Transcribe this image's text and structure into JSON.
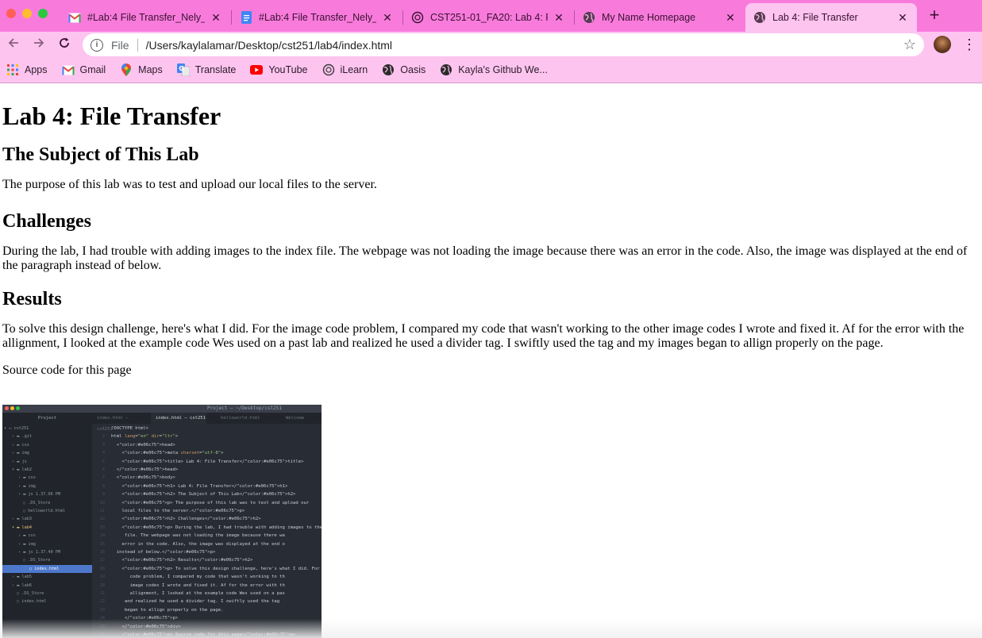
{
  "window": {
    "traffic_lights": {
      "close_color": "#fe5f57",
      "minimize_color": "#febc2e",
      "zoom_color": "#28c840"
    }
  },
  "tabs": [
    {
      "title": "#Lab:4 File Transfer_Nely_",
      "icon": "gmail-icon",
      "active": false
    },
    {
      "title": "#Lab:4 File Transfer_Nely_",
      "icon": "google-docs-icon",
      "active": false
    },
    {
      "title": "CST251-01_FA20: Lab 4: F",
      "icon": "ilearn-icon",
      "active": false
    },
    {
      "title": "My Name Homepage",
      "icon": "globe-icon",
      "active": false
    },
    {
      "title": "Lab 4: File Transfer",
      "icon": "globe-icon",
      "active": true
    }
  ],
  "toolbar": {
    "scheme_label": "File",
    "url": "/Users/kaylalamar/Desktop/cst251/lab4/index.html"
  },
  "bookmarks": [
    {
      "label": "Apps",
      "icon": "apps-grid-icon"
    },
    {
      "label": "Gmail",
      "icon": "gmail-icon"
    },
    {
      "label": "Maps",
      "icon": "maps-pin-icon"
    },
    {
      "label": "Translate",
      "icon": "translate-icon"
    },
    {
      "label": "YouTube",
      "icon": "youtube-icon"
    },
    {
      "label": "iLearn",
      "icon": "ilearn-icon"
    },
    {
      "label": "Oasis",
      "icon": "globe-icon"
    },
    {
      "label": "Kayla's Github We...",
      "icon": "globe-icon"
    }
  ],
  "theme": {
    "tabstrip_bg": "#f87bdc",
    "toolbar_bg": "#fdc4f0"
  },
  "page": {
    "title": "Lab 4: File Transfer",
    "subject_heading": "The Subject of This Lab",
    "subject_text": "The purpose of this lab was to test and upload our local files to the server.",
    "challenges_heading": "Challenges",
    "challenges_text": "During the lab, I had trouble with adding images to the index file. The webpage was not loading the image because there was an error in the code. Also, the image was displayed at the end of the paragraph instead of below.",
    "results_heading": "Results",
    "results_text": "To solve this design challenge, here's what I did. For the image code problem, I compared my code that wasn't working to the other image codes I wrote and fixed it. Af for the error with the allignment, I looked at the example code Wes used on a past lab and realized he used a divider tag. I swiftly used the tag and my images began to allign properly on the page.",
    "source_label": "Source code for this page"
  },
  "editor_screenshot": {
    "window_title": "Project — ~/Desktop/cst251",
    "project_header": "Project",
    "tabs": [
      "index.html — cst251",
      "index.html — cst251",
      "helloworld.html",
      "Welcome"
    ],
    "active_tab_index": 1,
    "tree": [
      {
        "label": "cst251",
        "kind": "root"
      },
      {
        "label": ".git",
        "kind": "folder"
      },
      {
        "label": "css",
        "kind": "folder"
      },
      {
        "label": "img",
        "kind": "folder"
      },
      {
        "label": "js",
        "kind": "folder"
      },
      {
        "label": "lab2",
        "kind": "folder-open"
      },
      {
        "label": "css",
        "kind": "folder"
      },
      {
        "label": "img",
        "kind": "folder"
      },
      {
        "label": "js 1.37.06 PM",
        "kind": "folder"
      },
      {
        "label": ".DS_Store",
        "kind": "file"
      },
      {
        "label": "helloworld.html",
        "kind": "file"
      },
      {
        "label": "lab3",
        "kind": "folder"
      },
      {
        "label": "lab4",
        "kind": "folder-open"
      },
      {
        "label": "css",
        "kind": "folder"
      },
      {
        "label": "img",
        "kind": "folder"
      },
      {
        "label": "js 1.37.40 PM",
        "kind": "folder"
      },
      {
        "label": ".DS_Store",
        "kind": "file"
      },
      {
        "label": "index.html",
        "kind": "file",
        "selected": true
      },
      {
        "label": "lab5",
        "kind": "folder"
      },
      {
        "label": "lab6",
        "kind": "folder"
      },
      {
        "label": ".DS_Store",
        "kind": "file"
      },
      {
        "label": "index.html",
        "kind": "file"
      }
    ],
    "code_lines": [
      "!DOCTYPE html>",
      "html lang=\"en\" dir=\"ltr\">",
      "  <head>",
      "    <meta charset=\"utf-8\">",
      "    <title> Lab 4: File Transfer</title>",
      "  </head>",
      "  <body>",
      "    <h1> Lab 4: File Transfer</h1>",
      "    <h2> The Subject of This Lab</h2>",
      "    <p> The purpose of this lab was to test and upload our",
      "    local files to the server.</p>",
      "    <h2> Challenges</h2>",
      "    <p> During the lab, I had trouble with adding images to the i",
      "     file. The webpage was not loading the image because there wa",
      "    error in the code. Also, the image was displayed at the end o",
      "  instead of below.</p>",
      "    <h2> Results</h2>",
      "    <p> To solve this design challenge, here's what I did. For th",
      "       code problem, I compared my code that wasn't working to th",
      "       image codes I wrote and fixed it. Af for the error with th",
      "       allignment, I looked at the example code Wes used on a pas",
      "     and realized he used a divider tag. I swiftly used the tag",
      "     began to allign properly on the page.",
      "     </p>",
      "    </div>",
      "    <p> Source code for this page</p>"
    ]
  }
}
